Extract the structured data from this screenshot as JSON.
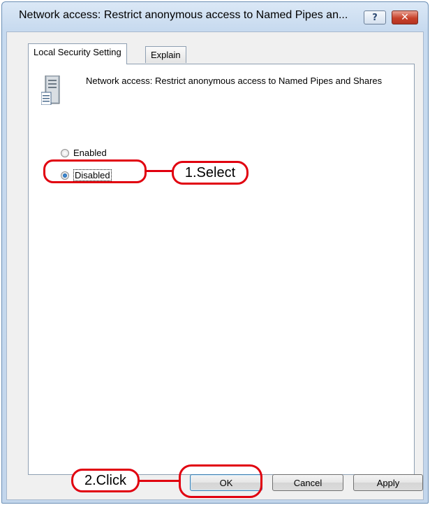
{
  "window": {
    "title": "Network access: Restrict anonymous access to Named Pipes an...",
    "help_label": "?",
    "close_label": "✕"
  },
  "tabs": [
    {
      "label": "Local Security Setting",
      "active": true
    },
    {
      "label": "Explain",
      "active": false
    }
  ],
  "policy": {
    "icon": "server-icon",
    "description": "Network access: Restrict anonymous access to Named Pipes and Shares"
  },
  "options": [
    {
      "label": "Enabled",
      "checked": false
    },
    {
      "label": "Disabled",
      "checked": true
    }
  ],
  "buttons": {
    "ok": "OK",
    "cancel": "Cancel",
    "apply": "Apply"
  },
  "annotations": {
    "step1": "1.Select",
    "step2": "2.Click",
    "color": "#e1000f"
  }
}
